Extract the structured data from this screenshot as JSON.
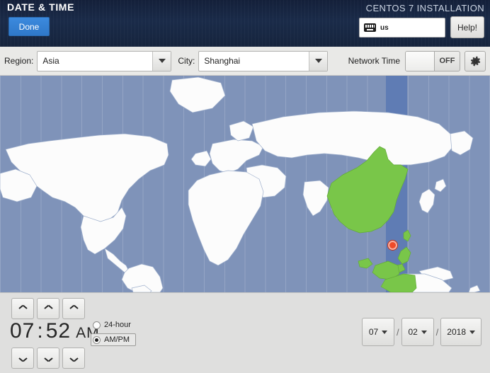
{
  "header": {
    "page_title": "DATE & TIME",
    "installer_title": "CENTOS 7 INSTALLATION",
    "done_label": "Done",
    "keyboard_layout": "us",
    "help_label": "Help!",
    "accent_color": "#2f78c9",
    "background_color": "#16243d"
  },
  "selector_bar": {
    "region_label": "Region:",
    "region_value": "Asia",
    "city_label": "City:",
    "city_value": "Shanghai",
    "network_time_label": "Network Time",
    "network_time_state": "OFF"
  },
  "map": {
    "ocean_color": "#7f93b9",
    "land_color": "#fcfcfc",
    "highlight_color": "#79c649",
    "selected_band_color": "#5f7cb4",
    "marker_color": "#ef4b2a"
  },
  "time": {
    "hour": "07",
    "minute": "52",
    "separator": ":",
    "ampm": "AM",
    "format_24h_label": "24-hour",
    "format_ampm_label": "AM/PM",
    "selected_format": "AM/PM"
  },
  "date": {
    "month": "07",
    "day": "02",
    "year": "2018",
    "separator": "/"
  }
}
